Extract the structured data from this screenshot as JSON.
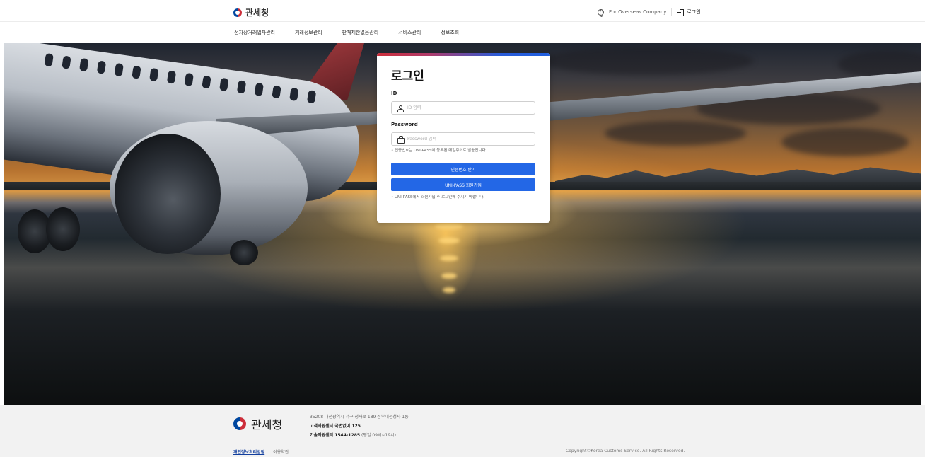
{
  "header": {
    "logo_text": "관세청",
    "overseas_link": "For Overseas Company",
    "login_link": "로그인",
    "nav": [
      "전자상거래업자관리",
      "거래정보관리",
      "판매제한없음관리",
      "서비스관리",
      "정보조회"
    ]
  },
  "login": {
    "title": "로그인",
    "id_label": "ID",
    "id_placeholder": "ID 입력",
    "password_label": "Password",
    "password_placeholder": "Password 입력",
    "password_note": "• 인증번호는 UNI-PASS에 등록된 메일주소로 발송됩니다.",
    "auth_button": "인증번호 받기",
    "signup_button": "UNI-PASS 회원가입",
    "signup_note": "• UNI-PASS에서 회원가입 후 로그인해 주시기 바랍니다."
  },
  "footer": {
    "logo_text": "관세청",
    "address": "35208 대전광역시 서구 청사로 189 정부대전청사 1동",
    "customer_center_label": "고객지원센터 국번없이 125",
    "tech_center_label": "기술지원센터 1544-1285",
    "tech_center_hours": "(평일 09시~19시)",
    "privacy_link": "개인정보처리방침",
    "terms_link": "이용약관",
    "copyright": "Copyright©Korea Customs Service. All Rights Reserved."
  },
  "colors": {
    "primary_button": "#2367e6",
    "accent_red": "#cd2e3a",
    "accent_blue": "#0047a0"
  }
}
